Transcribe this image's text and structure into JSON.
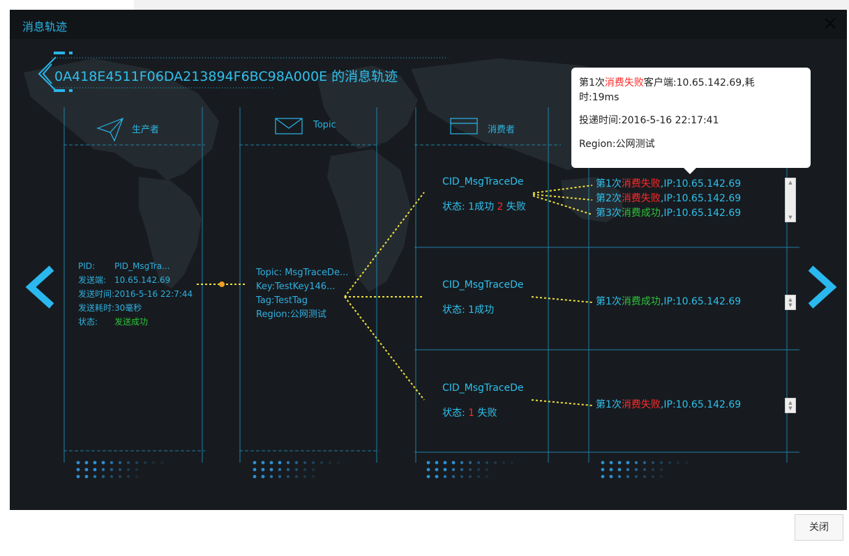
{
  "modal": {
    "title": "消息轨迹",
    "close_glyph": "✕"
  },
  "trace": {
    "title": "0A418E4511F06DA213894F6BC98A000E 的消息轨迹"
  },
  "columns": {
    "producer": "生产者",
    "topic": "Topic",
    "consumer": "消费者"
  },
  "producer": {
    "pid_label": "PID:",
    "pid_value": "PID_MsgTra...",
    "sender_label": "发送端:",
    "sender_value": "10.65.142.69",
    "time_label": "发送时间:",
    "time_value": "2016-5-16 22:7:44",
    "cost_label": "发送耗时:",
    "cost_value": "30毫秒",
    "status_label": "状态:",
    "status_value": "发送成功"
  },
  "topic": {
    "topic_line": "Topic: MsgTraceDe...",
    "key_line": "Key:TestKey146...",
    "tag_line": "Tag:TestTag",
    "region_line": "Region:公网测试"
  },
  "consumers": [
    {
      "cid": "CID_MsgTraceDe",
      "status_prefix": "状态: 1成功 ",
      "fail_count": "2",
      "status_suffix": " 失败",
      "attempts": [
        {
          "prefix": "第1次",
          "result": "消费失败",
          "ip": ",IP:10.65.142.69"
        },
        {
          "prefix": "第2次",
          "result": "消费失败",
          "ip": ",IP:10.65.142.69"
        },
        {
          "prefix": "第3次",
          "result": "消费成功",
          "ip": ",IP:10.65.142.69"
        }
      ]
    },
    {
      "cid": "CID_MsgTraceDe",
      "status_text": "状态: 1成功",
      "attempts": [
        {
          "prefix": "第1次",
          "result": "消费成功",
          "ip": ",IP:10.65.142.69"
        }
      ]
    },
    {
      "cid": "CID_MsgTraceDe",
      "status_prefix": "状态: ",
      "fail_count": "1",
      "status_suffix": " 失败",
      "attempts": [
        {
          "prefix": "第1次",
          "result": "消费失败",
          "ip": ",IP:10.65.142.69"
        }
      ]
    }
  ],
  "tooltip": {
    "line1_prefix": "第1次",
    "line1_result": "消费失败",
    "line1_rest": "客户端:10.65.142.69,耗",
    "line1_cont": "时:19ms",
    "line2": "投递时间:2016-5-16 22:17:41",
    "line3": "Region:公网测试"
  },
  "footer": {
    "close_label": "关闭"
  },
  "icons": {
    "prev": "chevron-left-icon",
    "next": "chevron-right-icon",
    "producer": "paper-plane-icon",
    "topic": "envelope-icon",
    "consumer": "inbox-icon"
  },
  "colors": {
    "accent": "#29b6e8",
    "success": "#2dc33a",
    "failure": "#ff2a2a",
    "connector": "#f0e13a",
    "background": "#171b1f"
  }
}
